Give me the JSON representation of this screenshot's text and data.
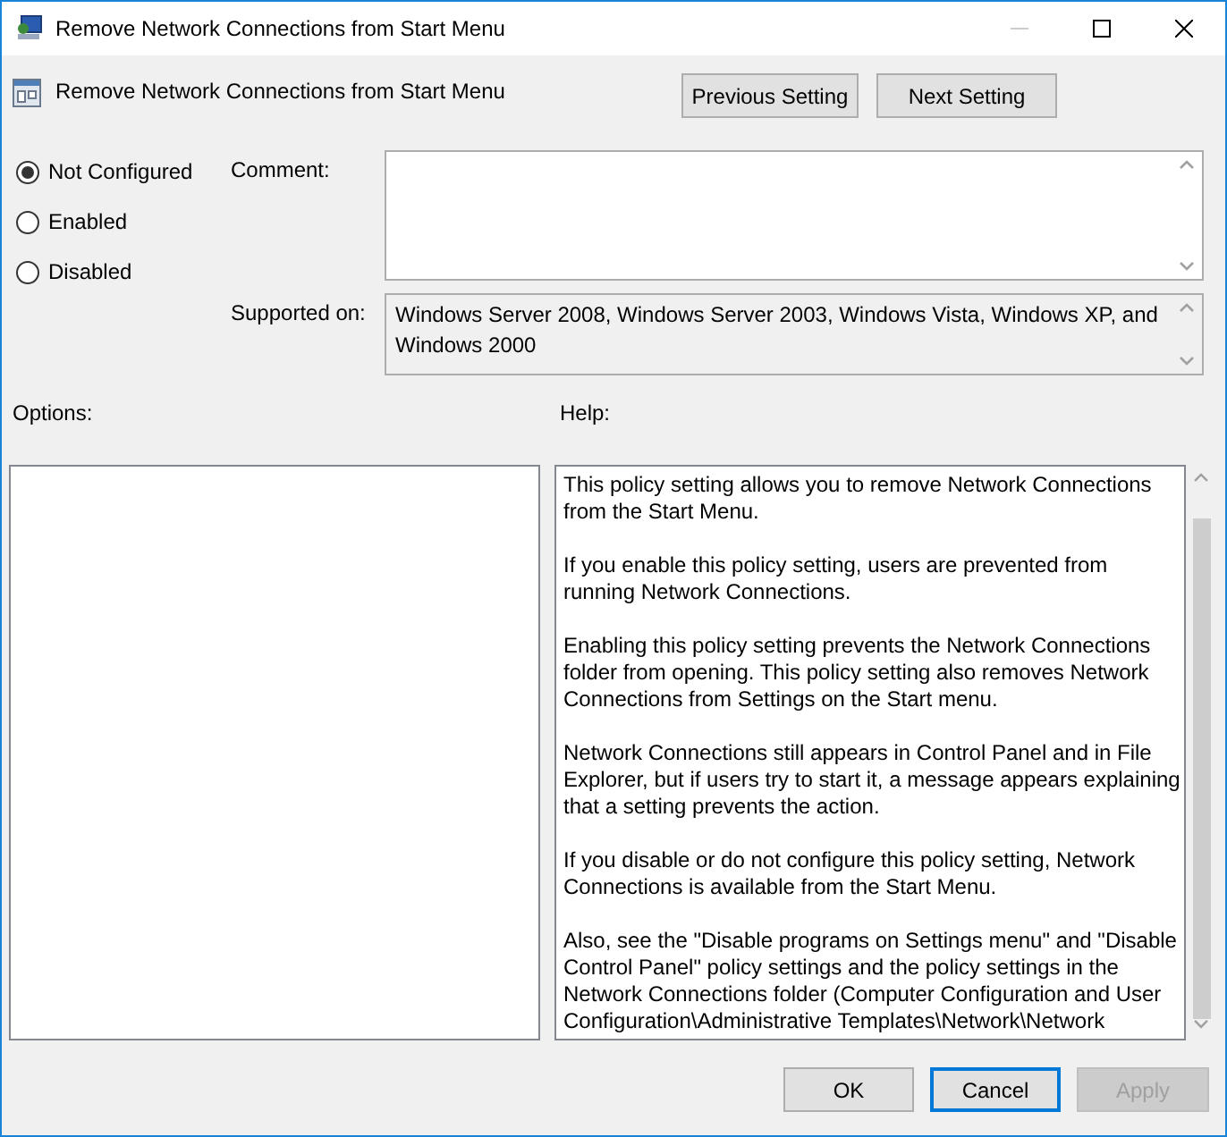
{
  "window": {
    "title": "Remove Network Connections from Start Menu"
  },
  "header": {
    "title": "Remove Network Connections from Start Menu",
    "buttons": [
      {
        "label": "Previous Setting"
      },
      {
        "label": "Next Setting"
      }
    ]
  },
  "options": [
    {
      "label": "Not Configured",
      "selected": true
    },
    {
      "label": "Enabled",
      "selected": false
    },
    {
      "label": "Disabled",
      "selected": false
    }
  ],
  "comment": {
    "label": "Comment:"
  },
  "supported": {
    "label": "Supported on:",
    "value": "Windows Server 2008, Windows Server 2003, Windows Vista, Windows XP, and Windows 2000"
  },
  "options_label": "Options:",
  "help_label": "Help:",
  "help": [
    {
      "lines": [
        "This policy setting allows you to remove Network Connections",
        "from the Start Menu."
      ]
    },
    {
      "lines": [
        "If you enable this policy setting, users are prevented from",
        "running Network Connections."
      ]
    },
    {
      "lines": [
        "Enabling this policy setting prevents the Network Connections",
        "folder from opening. This policy setting also removes Network",
        "Connections from Settings on the Start menu."
      ]
    },
    {
      "lines": [
        "Network Connections still appears in Control Panel and in File",
        "Explorer, but if users try to start it, a message appears explaining",
        "that a setting prevents the action."
      ]
    },
    {
      "lines": [
        "If you disable or do not configure this policy setting, Network",
        "Connections is available from the Start Menu."
      ]
    },
    {
      "lines": [
        "Also, see the \"Disable programs on Settings menu\" and \"Disable",
        "Control Panel\" policy settings and the policy settings in the",
        "Network Connections folder (Computer Configuration and User",
        "Configuration\\Administrative Templates\\Network\\Network"
      ]
    }
  ],
  "buttons": [
    {
      "label": "OK",
      "focused": false,
      "disabled": false
    },
    {
      "label": "Cancel",
      "focused": true,
      "disabled": false
    },
    {
      "label": "Apply",
      "focused": false,
      "disabled": true
    }
  ]
}
